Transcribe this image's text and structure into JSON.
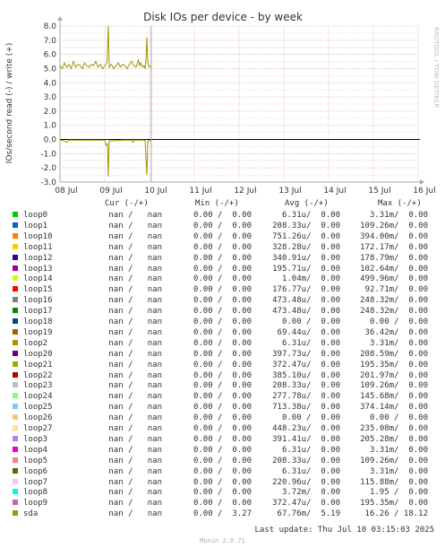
{
  "chart_data": {
    "type": "line",
    "title": "Disk IOs per device - by week",
    "ylabel": "IOs/second read (-) / write (+)",
    "watermark": "RRDTOOL / TOBI OETIKER",
    "ylim": [
      -3.0,
      8.0
    ],
    "yticks": [
      "8.0",
      "7.0",
      "6.0",
      "5.0",
      "4.0",
      "3.0",
      "2.0",
      "1.0",
      "0.0",
      "-1.0",
      "-2.0",
      "-3.0"
    ],
    "xticks": [
      "08 Jul",
      "09 Jul",
      "10 Jul",
      "11 Jul",
      "12 Jul",
      "13 Jul",
      "14 Jul",
      "15 Jul",
      "16 Jul"
    ],
    "series": [
      {
        "name": "sda",
        "color": "#999900",
        "write": [
          [
            0.0,
            5.2
          ],
          [
            0.05,
            5.0
          ],
          [
            0.1,
            5.4
          ],
          [
            0.15,
            5.1
          ],
          [
            0.2,
            5.3
          ],
          [
            0.25,
            5.0
          ],
          [
            0.3,
            5.5
          ],
          [
            0.35,
            5.1
          ],
          [
            0.4,
            5.3
          ],
          [
            0.45,
            5.2
          ],
          [
            0.5,
            5.0
          ],
          [
            0.55,
            5.4
          ],
          [
            0.6,
            5.2
          ],
          [
            0.65,
            5.1
          ],
          [
            0.7,
            5.3
          ],
          [
            0.75,
            5.2
          ],
          [
            0.8,
            5.5
          ],
          [
            0.85,
            5.1
          ],
          [
            0.9,
            5.3
          ],
          [
            0.95,
            5.0
          ],
          [
            1.0,
            5.2
          ],
          [
            1.05,
            5.4
          ],
          [
            1.08,
            8.0
          ],
          [
            1.1,
            5.1
          ],
          [
            1.15,
            5.3
          ],
          [
            1.2,
            5.0
          ],
          [
            1.25,
            5.2
          ],
          [
            1.3,
            5.4
          ],
          [
            1.35,
            5.1
          ],
          [
            1.4,
            5.3
          ],
          [
            1.45,
            5.2
          ],
          [
            1.5,
            5.0
          ],
          [
            1.55,
            5.3
          ],
          [
            1.6,
            5.5
          ],
          [
            1.65,
            5.2
          ],
          [
            1.7,
            5.1
          ],
          [
            1.75,
            5.6
          ],
          [
            1.78,
            5.2
          ],
          [
            1.8,
            5.4
          ],
          [
            1.85,
            5.1
          ],
          [
            1.88,
            5.2
          ],
          [
            1.9,
            5.0
          ],
          [
            1.92,
            5.6
          ],
          [
            1.94,
            7.2
          ],
          [
            1.96,
            5.4
          ],
          [
            2.0,
            5.1
          ],
          [
            2.03,
            5.2
          ]
        ],
        "read": [
          [
            0.0,
            -0.05
          ],
          [
            0.1,
            -0.1
          ],
          [
            0.15,
            -0.2
          ],
          [
            0.2,
            -0.05
          ],
          [
            0.5,
            -0.05
          ],
          [
            1.0,
            -0.05
          ],
          [
            1.03,
            -0.4
          ],
          [
            1.06,
            -0.3
          ],
          [
            1.08,
            -2.6
          ],
          [
            1.1,
            -0.1
          ],
          [
            1.4,
            -0.05
          ],
          [
            1.6,
            -0.05
          ],
          [
            1.63,
            -0.2
          ],
          [
            1.66,
            -0.05
          ],
          [
            1.85,
            -0.05
          ],
          [
            1.9,
            -0.05
          ],
          [
            1.94,
            -2.5
          ],
          [
            1.96,
            -0.1
          ],
          [
            2.03,
            -0.05
          ]
        ]
      }
    ]
  },
  "legend_header": {
    "cur": "Cur (-/+)",
    "min": "Min (-/+)",
    "avg": "Avg (-/+)",
    "max": "Max (-/+)"
  },
  "legend": [
    {
      "name": "loop0",
      "color": "#00cc00",
      "cur": "nan /   nan",
      "min": "0.00 /  0.00",
      "avg": "6.31u/  0.00",
      "max": "3.31m/  0.00"
    },
    {
      "name": "loop1",
      "color": "#0066b3",
      "cur": "nan /   nan",
      "min": "0.00 /  0.00",
      "avg": "208.33u/  0.00",
      "max": "109.26m/  0.00"
    },
    {
      "name": "loop10",
      "color": "#ff8000",
      "cur": "nan /   nan",
      "min": "0.00 /  0.00",
      "avg": "751.26u/  0.00",
      "max": "394.00m/  0.00"
    },
    {
      "name": "loop11",
      "color": "#ffcc00",
      "cur": "nan /   nan",
      "min": "0.00 /  0.00",
      "avg": "328.28u/  0.00",
      "max": "172.17m/  0.00"
    },
    {
      "name": "loop12",
      "color": "#330099",
      "cur": "nan /   nan",
      "min": "0.00 /  0.00",
      "avg": "340.91u/  0.00",
      "max": "178.79m/  0.00"
    },
    {
      "name": "loop13",
      "color": "#990099",
      "cur": "nan /   nan",
      "min": "0.00 /  0.00",
      "avg": "195.71u/  0.00",
      "max": "102.64m/  0.00"
    },
    {
      "name": "loop14",
      "color": "#ccff00",
      "cur": "nan /   nan",
      "min": "0.00 /  0.00",
      "avg": "1.04m/  0.00",
      "max": "499.96m/  0.00"
    },
    {
      "name": "loop15",
      "color": "#ff0000",
      "cur": "nan /   nan",
      "min": "0.00 /  0.00",
      "avg": "176.77u/  0.00",
      "max": "92.71m/  0.00"
    },
    {
      "name": "loop16",
      "color": "#808080",
      "cur": "nan /   nan",
      "min": "0.00 /  0.00",
      "avg": "473.48u/  0.00",
      "max": "248.32m/  0.00"
    },
    {
      "name": "loop17",
      "color": "#008f00",
      "cur": "nan /   nan",
      "min": "0.00 /  0.00",
      "avg": "473.48u/  0.00",
      "max": "248.32m/  0.00"
    },
    {
      "name": "loop18",
      "color": "#00487d",
      "cur": "nan /   nan",
      "min": "0.00 /  0.00",
      "avg": "0.00 /  0.00",
      "max": "0.00 /  0.00"
    },
    {
      "name": "loop19",
      "color": "#b35a00",
      "cur": "nan /   nan",
      "min": "0.00 /  0.00",
      "avg": "69.44u/  0.00",
      "max": "36.42m/  0.00"
    },
    {
      "name": "loop2",
      "color": "#b38f00",
      "cur": "nan /   nan",
      "min": "0.00 /  0.00",
      "avg": "6.31u/  0.00",
      "max": "3.31m/  0.00"
    },
    {
      "name": "loop20",
      "color": "#6b006b",
      "cur": "nan /   nan",
      "min": "0.00 /  0.00",
      "avg": "397.73u/  0.00",
      "max": "208.59m/  0.00"
    },
    {
      "name": "loop21",
      "color": "#8fb300",
      "cur": "nan /   nan",
      "min": "0.00 /  0.00",
      "avg": "372.47u/  0.00",
      "max": "195.35m/  0.00"
    },
    {
      "name": "loop22",
      "color": "#b30000",
      "cur": "nan /   nan",
      "min": "0.00 /  0.00",
      "avg": "385.10u/  0.00",
      "max": "201.97m/  0.00"
    },
    {
      "name": "loop23",
      "color": "#bebebe",
      "cur": "nan /   nan",
      "min": "0.00 /  0.00",
      "avg": "208.33u/  0.00",
      "max": "109.26m/  0.00"
    },
    {
      "name": "loop24",
      "color": "#80ff80",
      "cur": "nan /   nan",
      "min": "0.00 /  0.00",
      "avg": "277.78u/  0.00",
      "max": "145.68m/  0.00"
    },
    {
      "name": "loop25",
      "color": "#80c9ff",
      "cur": "nan /   nan",
      "min": "0.00 /  0.00",
      "avg": "713.38u/  0.00",
      "max": "374.14m/  0.00"
    },
    {
      "name": "loop26",
      "color": "#ffc080",
      "cur": "nan /   nan",
      "min": "0.00 /  0.00",
      "avg": "0.00 /  0.00",
      "max": "0.00 /  0.00"
    },
    {
      "name": "loop27",
      "color": "#ffe680",
      "cur": "nan /   nan",
      "min": "0.00 /  0.00",
      "avg": "448.23u/  0.00",
      "max": "235.08m/  0.00"
    },
    {
      "name": "loop3",
      "color": "#aa80ff",
      "cur": "nan /   nan",
      "min": "0.00 /  0.00",
      "avg": "391.41u/  0.00",
      "max": "205.28m/  0.00"
    },
    {
      "name": "loop4",
      "color": "#ee00cc",
      "cur": "nan /   nan",
      "min": "0.00 /  0.00",
      "avg": "6.31u/  0.00",
      "max": "3.31m/  0.00"
    },
    {
      "name": "loop5",
      "color": "#ff8080",
      "cur": "nan /   nan",
      "min": "0.00 /  0.00",
      "avg": "208.33u/  0.00",
      "max": "109.26m/  0.00"
    },
    {
      "name": "loop6",
      "color": "#666600",
      "cur": "nan /   nan",
      "min": "0.00 /  0.00",
      "avg": "6.31u/  0.00",
      "max": "3.31m/  0.00"
    },
    {
      "name": "loop7",
      "color": "#ffbfff",
      "cur": "nan /   nan",
      "min": "0.00 /  0.00",
      "avg": "220.96u/  0.00",
      "max": "115.88m/  0.00"
    },
    {
      "name": "loop8",
      "color": "#00ffcc",
      "cur": "nan /   nan",
      "min": "0.00 /  0.00",
      "avg": "3.72m/  0.00",
      "max": "1.95 /  0.00"
    },
    {
      "name": "loop9",
      "color": "#cc6699",
      "cur": "nan /   nan",
      "min": "0.00 /  0.00",
      "avg": "372.47u/  0.00",
      "max": "195.35m/  0.00"
    },
    {
      "name": "sda",
      "color": "#999900",
      "cur": "nan /   nan",
      "min": "0.00 /  3.27",
      "avg": "67.76m/  5.19",
      "max": "16.26 / 18.12"
    }
  ],
  "last_update": "Last update: Thu Jul 10 03:15:03 2025",
  "footer": "Munin 2.0.71"
}
